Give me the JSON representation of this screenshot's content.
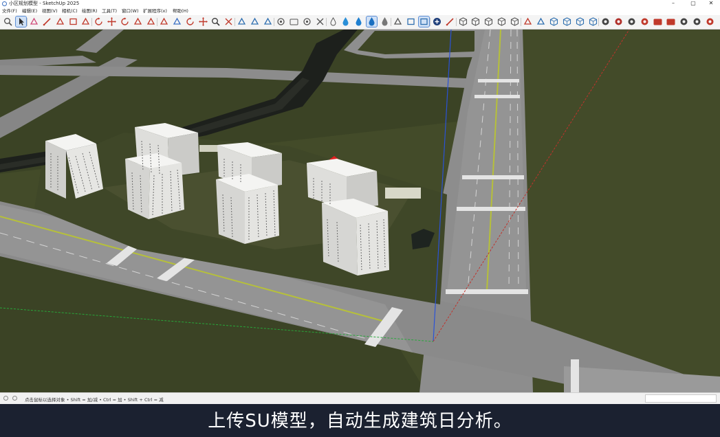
{
  "window": {
    "title": "小区规划模型 - SketchUp 2025",
    "minimize_glyph": "–",
    "maximize_glyph": "▢",
    "close_glyph": "✕"
  },
  "menubar": {
    "items": [
      {
        "label": "文件(F)"
      },
      {
        "label": "编辑(E)"
      },
      {
        "label": "视图(V)"
      },
      {
        "label": "相机(C)"
      },
      {
        "label": "绘图(R)"
      },
      {
        "label": "工具(T)"
      },
      {
        "label": "窗口(W)"
      },
      {
        "label": "扩展程序(x)"
      },
      {
        "label": "帮助(H)"
      }
    ]
  },
  "toolbar": {
    "tools": [
      {
        "icon": "zoom-search-icon",
        "color": "#4a4a4a"
      },
      {
        "icon": "select-arrow-icon",
        "color": "#2b2b2b",
        "active": true
      },
      {
        "icon": "eraser-icon",
        "color": "#d04a7a"
      },
      {
        "icon": "pencil-line-icon",
        "color": "#c0392b"
      },
      {
        "icon": "arc-icon",
        "color": "#c0392b"
      },
      {
        "icon": "rectangle-icon",
        "color": "#c0392b"
      },
      {
        "icon": "push-pull-icon",
        "color": "#c0392b"
      },
      {
        "icon": "offset-icon",
        "color": "#c0392b"
      },
      {
        "icon": "move-icon",
        "color": "#c0392b"
      },
      {
        "icon": "rotate-icon",
        "color": "#c0392b"
      },
      {
        "icon": "scale-icon",
        "color": "#c0392b"
      },
      {
        "icon": "follow-me-icon",
        "color": "#c0392b"
      },
      {
        "icon": "tape-measure-icon",
        "color": "#c0392b"
      },
      {
        "icon": "paint-bucket-icon",
        "color": "#3a6fc4"
      },
      {
        "icon": "orbit-icon",
        "color": "#c0392b"
      },
      {
        "icon": "pan-icon",
        "color": "#c0392b"
      },
      {
        "icon": "zoom-icon",
        "color": "#333333"
      },
      {
        "icon": "zoom-extents-icon",
        "color": "#c0392b"
      },
      {
        "icon": "3d-warehouse-icon",
        "color": "#2f6fb0"
      },
      {
        "icon": "extension-warehouse-icon",
        "color": "#2f6fb0"
      },
      {
        "icon": "sandbox-icon",
        "color": "#2f6fb0"
      },
      {
        "icon": "account-icon",
        "color": "#555555"
      },
      {
        "icon": "folder-icon",
        "color": "#555555"
      },
      {
        "icon": "settings-gear-icon",
        "color": "#555555"
      },
      {
        "icon": "close-x-icon",
        "color": "#555555"
      },
      {
        "icon": "drop-outline-icon",
        "color": "#555555"
      },
      {
        "icon": "drop-light-icon",
        "color": "#2a8fd8"
      },
      {
        "icon": "drop-blue-icon",
        "color": "#1e7fd0"
      },
      {
        "icon": "drop-filled-icon",
        "color": "#1a6fc0",
        "active": true
      },
      {
        "icon": "drop-gray-icon",
        "color": "#777777"
      },
      {
        "icon": "axes-icon",
        "color": "#555555"
      },
      {
        "icon": "section-plane-icon",
        "color": "#2f6fb0"
      },
      {
        "icon": "section-cut-icon",
        "color": "#2f6fb0",
        "active": true
      },
      {
        "icon": "add-circle-icon",
        "color": "#1f3f7a"
      },
      {
        "icon": "line-red-icon",
        "color": "#c0392b"
      },
      {
        "icon": "iso-view-icon",
        "color": "#555555"
      },
      {
        "icon": "top-view-icon",
        "color": "#555555"
      },
      {
        "icon": "front-view-icon",
        "color": "#555555"
      },
      {
        "icon": "right-view-icon",
        "color": "#555555"
      },
      {
        "icon": "back-view-icon",
        "color": "#555555"
      },
      {
        "icon": "component-icon",
        "color": "#c0392b"
      },
      {
        "icon": "group-icon",
        "color": "#2f6fb0"
      },
      {
        "icon": "style-xray-icon",
        "color": "#2f6fb0"
      },
      {
        "icon": "style-wireframe-icon",
        "color": "#2f6fb0"
      },
      {
        "icon": "style-shaded-icon",
        "color": "#2f6fb0"
      },
      {
        "icon": "style-textured-icon",
        "color": "#2f6fb0"
      },
      {
        "icon": "plugin-a-icon",
        "color": "#444444"
      },
      {
        "icon": "plugin-b-icon",
        "color": "#b0302a"
      },
      {
        "icon": "plugin-c-icon",
        "color": "#444444"
      },
      {
        "icon": "plugin-d-icon",
        "color": "#c0392b"
      },
      {
        "icon": "image-icon",
        "color": "#c0392b"
      },
      {
        "icon": "book-icon",
        "color": "#c0392b"
      },
      {
        "icon": "plugin-e-icon",
        "color": "#444444"
      },
      {
        "icon": "plugin-f-icon",
        "color": "#444444"
      },
      {
        "icon": "plugin-g-icon",
        "color": "#c0392b"
      }
    ]
  },
  "scene": {
    "colors": {
      "ground": "#3b4325",
      "ground_light": "#454d2b",
      "road": "#8a8a8a",
      "road_light": "#9a9a9a",
      "lane_line": "#d8d8d8",
      "center_line": "#b6c03a",
      "river": "#1c1e1c",
      "building_face": "#e8e8e6",
      "building_window": "#6a6a6a",
      "axis_blue": "#2a52d8",
      "axis_red": "#c0332c",
      "axis_green": "#27a83a"
    }
  },
  "statusbar": {
    "hint": "点击鼠标以选择对象 • Shift = 加/减 • Ctrl = 加 • Shift + Ctrl = 减"
  },
  "caption": {
    "text": "上传SU模型，自动生成建筑日分析。"
  }
}
